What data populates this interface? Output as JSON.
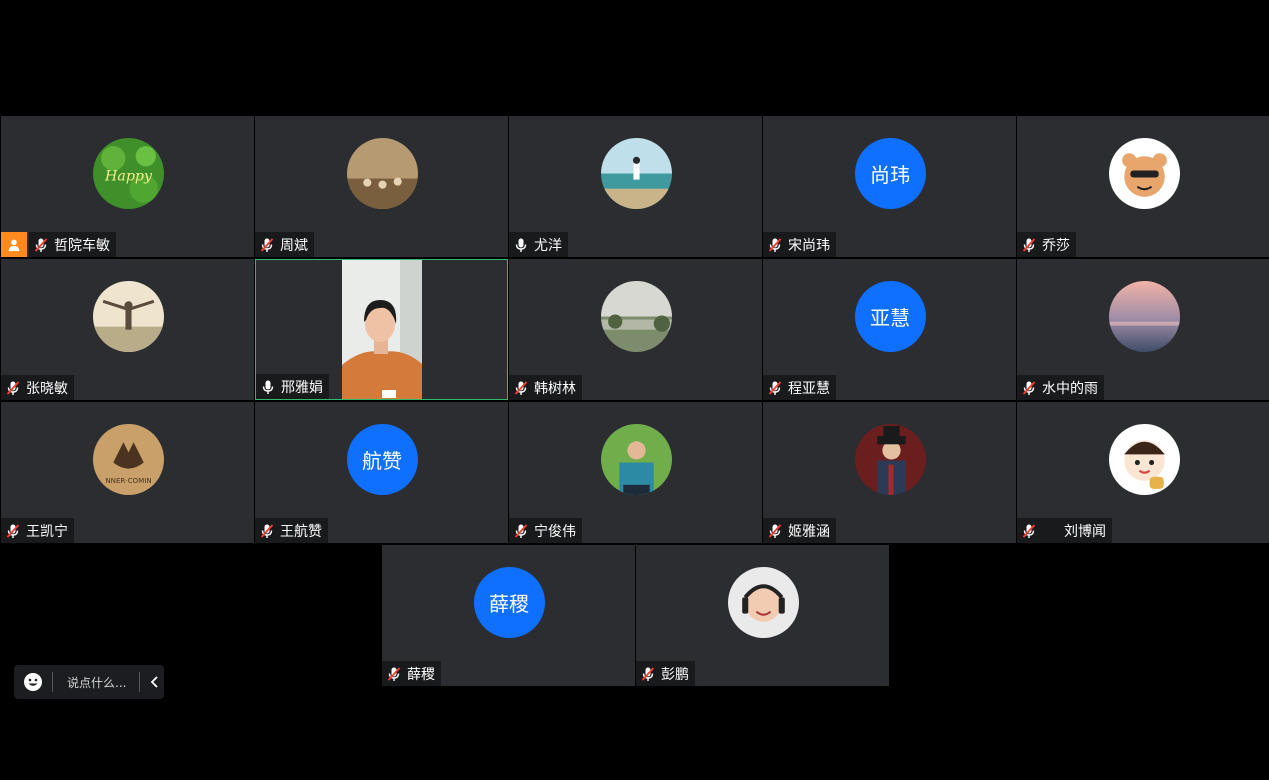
{
  "participants": [
    {
      "name": "哲院车敏",
      "mic": "muted",
      "host": true,
      "avatar_type": "image",
      "avatar": "happy-clover"
    },
    {
      "name": "周斌",
      "mic": "muted",
      "avatar_type": "image",
      "avatar": "crowd-photo"
    },
    {
      "name": "尤洋",
      "mic": "on",
      "avatar_type": "image",
      "avatar": "beach-photo"
    },
    {
      "name": "宋尚玮",
      "mic": "muted",
      "avatar_type": "text",
      "avatar_text": "尚玮",
      "avatar_color": "#0f6fff"
    },
    {
      "name": "乔莎",
      "mic": "muted",
      "avatar_type": "image",
      "avatar": "cartoon-tiger"
    },
    {
      "name": "张晓敏",
      "mic": "muted",
      "avatar_type": "image",
      "avatar": "sunset-person"
    },
    {
      "name": "邢雅娟",
      "mic": "on",
      "avatar_type": "video",
      "active_speaker": true
    },
    {
      "name": "韩树林",
      "mic": "muted",
      "avatar_type": "image",
      "avatar": "lake-photo"
    },
    {
      "name": "程亚慧",
      "mic": "muted",
      "avatar_type": "text",
      "avatar_text": "亚慧",
      "avatar_color": "#0f6fff"
    },
    {
      "name": "水中的雨",
      "mic": "muted",
      "avatar_type": "image",
      "avatar": "pink-sky"
    },
    {
      "name": "王凯宁",
      "mic": "muted",
      "avatar_type": "image",
      "avatar": "wolf-emblem"
    },
    {
      "name": "王航赞",
      "mic": "muted",
      "avatar_type": "text",
      "avatar_text": "航赞",
      "avatar_color": "#0f6fff"
    },
    {
      "name": "宁俊伟",
      "mic": "muted",
      "avatar_type": "image",
      "avatar": "man-portrait"
    },
    {
      "name": "姬雅涵",
      "mic": "muted",
      "avatar_type": "image",
      "avatar": "gentleman-hat"
    },
    {
      "name": "刘博闻",
      "mic": "muted",
      "avatar_type": "image",
      "avatar": "cartoon-boy"
    },
    {
      "name": "薛稷",
      "mic": "muted",
      "avatar_type": "text",
      "avatar_text": "薛稷",
      "avatar_color": "#0f6fff"
    },
    {
      "name": "彭鹏",
      "mic": "muted",
      "avatar_type": "image",
      "avatar": "child-headphones"
    }
  ],
  "chat": {
    "placeholder": "说点什么...",
    "emoji_icon": "emoji-icon",
    "collapse_icon": "chevron-left-icon"
  },
  "colors": {
    "background": "#000000",
    "tile": "#2b2d31",
    "text_avatar": "#0f6fff",
    "active_border": "#2fbd6c",
    "host_badge": "#ff8a1f",
    "muted_mic": "#ff3b30"
  }
}
